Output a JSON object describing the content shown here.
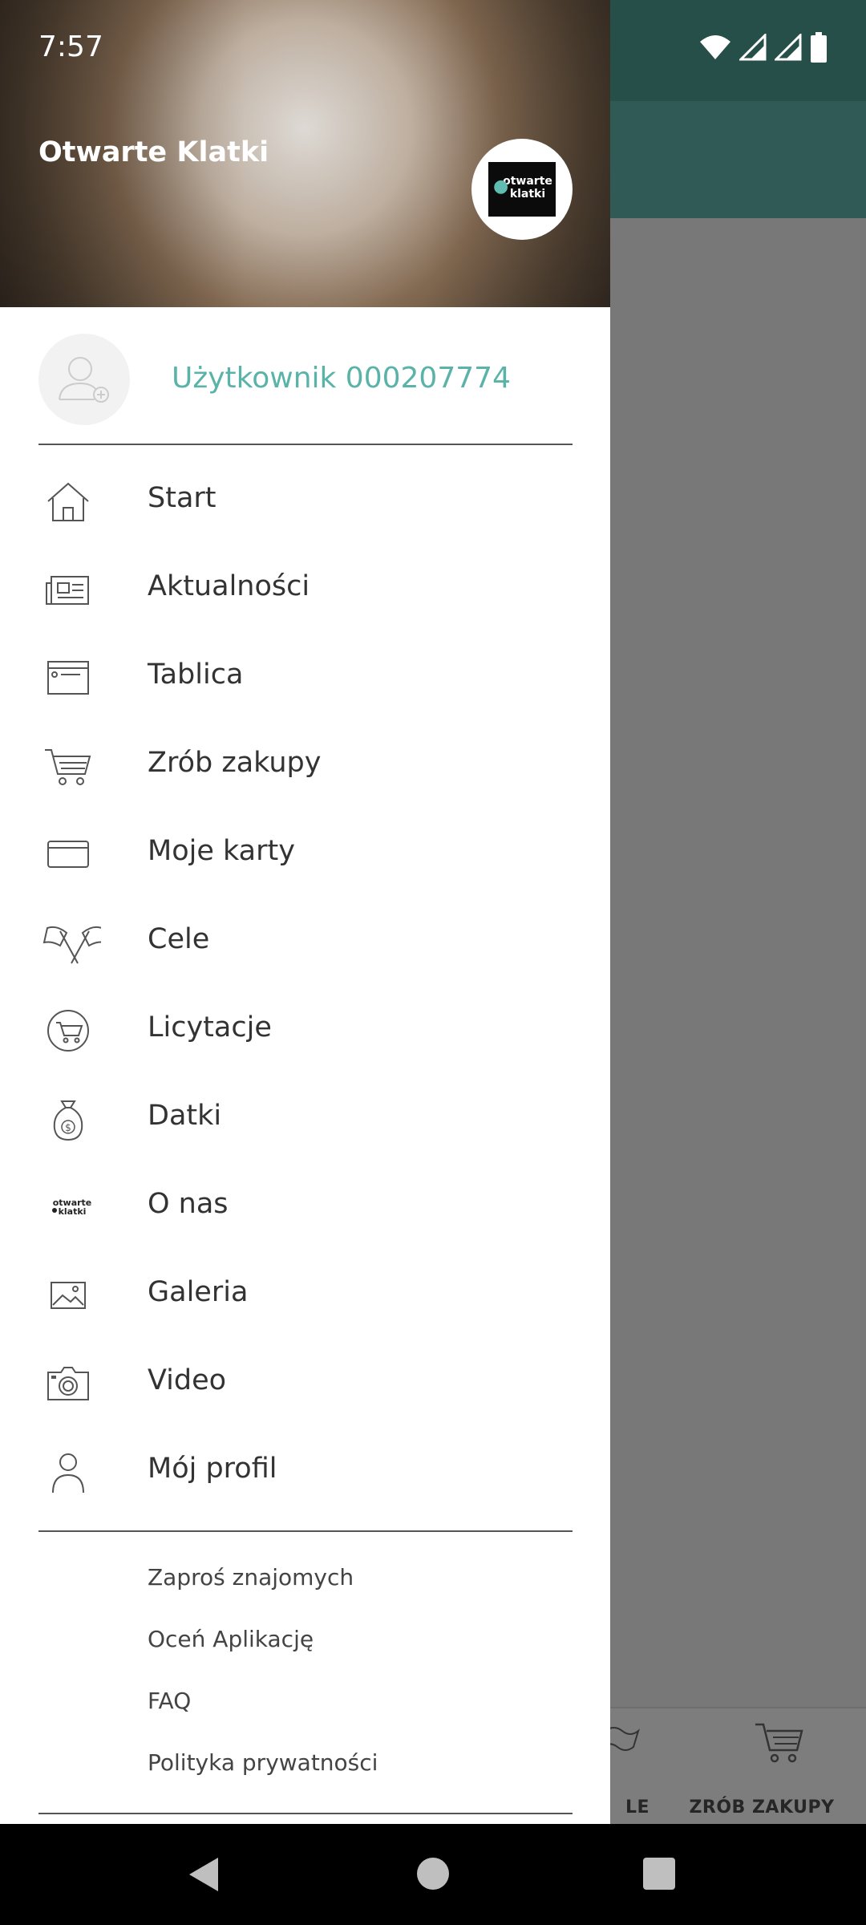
{
  "status_bar": {
    "time": "7:57"
  },
  "drawer": {
    "header_title": "Otwarte Klatki",
    "logo_text": "otwarte klatki",
    "user_name": "Użytkownik 000207774",
    "menu": [
      {
        "label": "Start",
        "icon": "home-icon"
      },
      {
        "label": "Aktualności",
        "icon": "news-icon"
      },
      {
        "label": "Tablica",
        "icon": "board-icon"
      },
      {
        "label": "Zrób zakupy",
        "icon": "cart-icon"
      },
      {
        "label": "Moje karty",
        "icon": "card-icon"
      },
      {
        "label": "Cele",
        "icon": "flags-icon"
      },
      {
        "label": "Licytacje",
        "icon": "auction-cart-icon"
      },
      {
        "label": "Datki",
        "icon": "money-bag-icon"
      },
      {
        "label": "O nas",
        "icon": "otwarte-klatki-logo-icon"
      },
      {
        "label": "Galeria",
        "icon": "image-icon"
      },
      {
        "label": "Video",
        "icon": "camera-icon"
      },
      {
        "label": "Mój profil",
        "icon": "person-icon"
      }
    ],
    "secondary": [
      {
        "label": "Zaproś znajomych"
      },
      {
        "label": "Oceń Aplikację"
      },
      {
        "label": "FAQ"
      },
      {
        "label": "Polityka prywatności"
      }
    ]
  },
  "bottom_nav": {
    "cele_partial": "LE",
    "zrob_zakupy": "ZRÓB ZAKUPY"
  }
}
